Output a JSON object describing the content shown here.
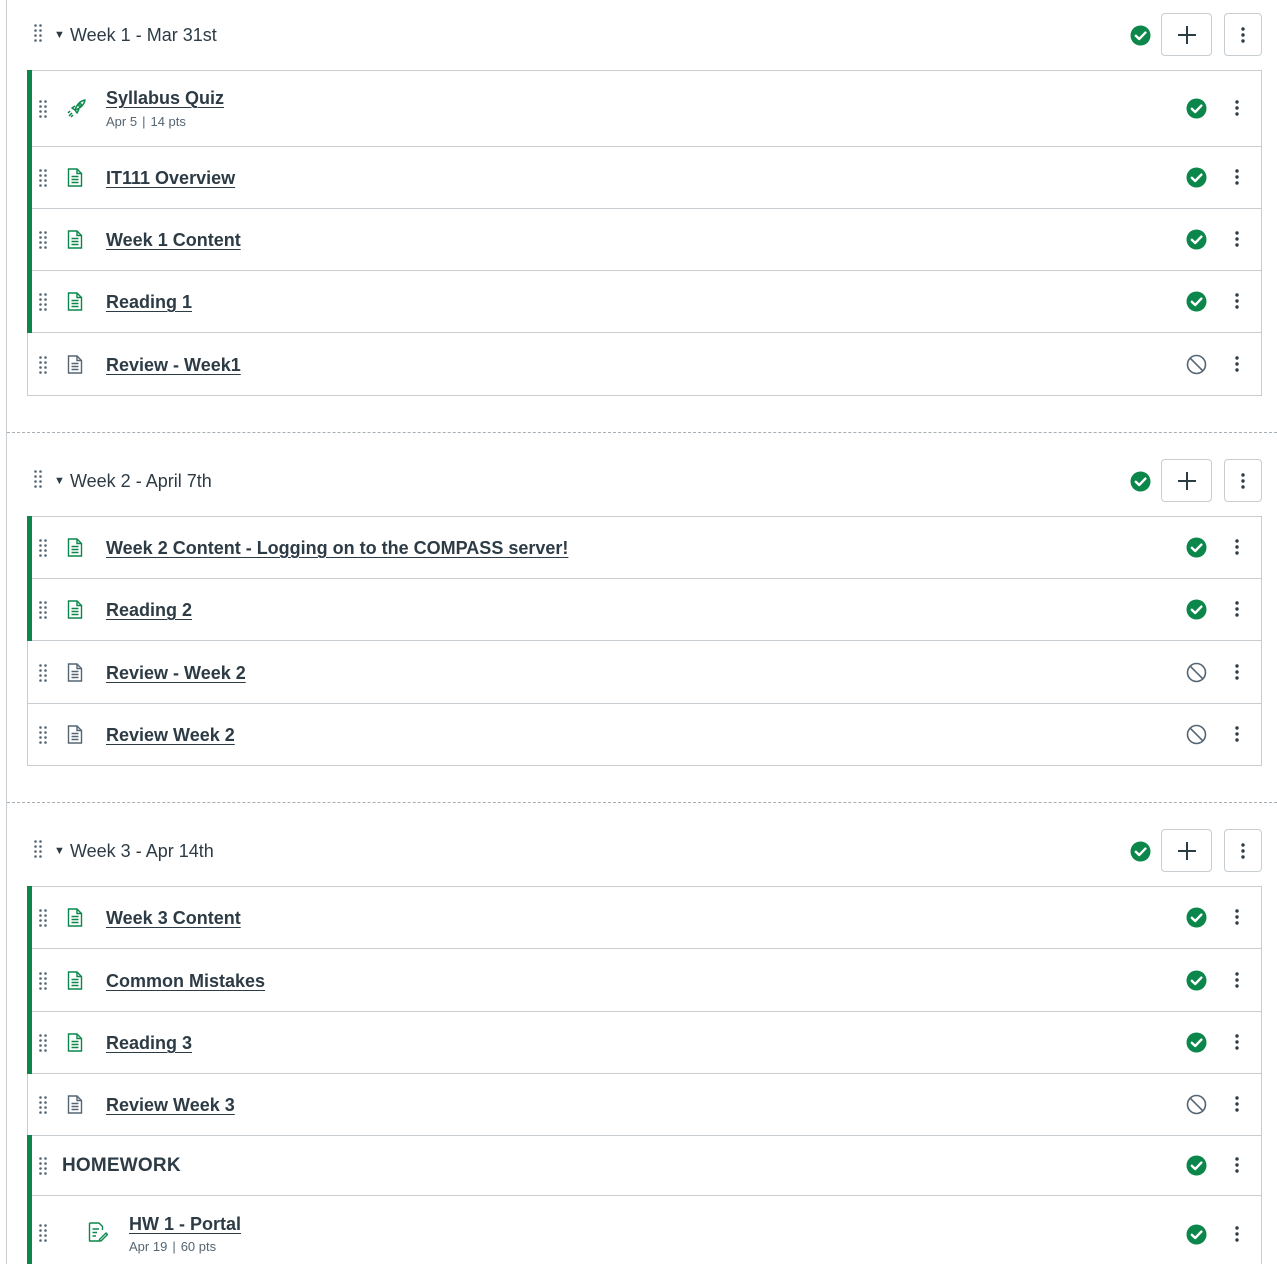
{
  "colors": {
    "published": "#0b874b",
    "text": "#2d3b45",
    "muted": "#556572",
    "border": "#c7cdd1"
  },
  "modules": [
    {
      "title": "Week 1 - Mar 31st",
      "published": true,
      "items": [
        {
          "type": "quiz",
          "label": "Syllabus Quiz",
          "due": "Apr 5",
          "points": "14 pts",
          "published": true
        },
        {
          "type": "page",
          "label": "IT111 Overview",
          "published": true
        },
        {
          "type": "page",
          "label": "Week 1 Content",
          "published": true
        },
        {
          "type": "page",
          "label": "Reading 1",
          "published": true
        },
        {
          "type": "page",
          "label": "Review - Week1",
          "published": false
        }
      ]
    },
    {
      "title": "Week 2 - April 7th",
      "published": true,
      "items": [
        {
          "type": "page",
          "label": "Week 2 Content - Logging on to the COMPASS server!",
          "published": true
        },
        {
          "type": "page",
          "label": "Reading 2",
          "published": true
        },
        {
          "type": "page",
          "label": "Review - Week 2",
          "published": false
        },
        {
          "type": "page",
          "label": "Review Week 2",
          "published": false
        }
      ]
    },
    {
      "title": "Week 3 - Apr 14th",
      "published": true,
      "items": [
        {
          "type": "page",
          "label": "Week 3 Content",
          "published": true
        },
        {
          "type": "page",
          "label": "Common Mistakes",
          "published": true
        },
        {
          "type": "page",
          "label": "Reading 3",
          "published": true
        },
        {
          "type": "page",
          "label": "Review Week 3",
          "published": false
        },
        {
          "type": "subheader",
          "label": "HOMEWORK",
          "published": true
        },
        {
          "type": "assignment",
          "label": "HW 1 - Portal",
          "due": "Apr 19",
          "points": "60 pts",
          "published": true
        }
      ]
    }
  ]
}
